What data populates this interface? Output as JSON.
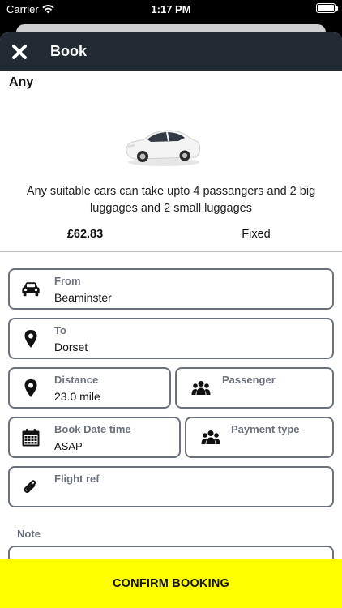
{
  "status_bar": {
    "carrier": "Carrier",
    "time": "1:17 PM"
  },
  "header": {
    "title": "Book",
    "close_icon": "close-icon"
  },
  "vehicle": {
    "name": "Any",
    "description": "Any suitable cars can take upto 4 passangers and 2 big luggages and 2 small luggages",
    "price": "£62.83",
    "fare_type": "Fixed"
  },
  "form": {
    "from": {
      "label": "From",
      "value": "Beaminster",
      "icon": "car-icon"
    },
    "to": {
      "label": "To",
      "value": "Dorset",
      "icon": "location-pin-icon"
    },
    "distance": {
      "label": "Distance",
      "value": "23.0 mile",
      "icon": "location-pin-icon"
    },
    "passenger": {
      "label": "Passenger",
      "value": "",
      "icon": "people-icon"
    },
    "book_datetime": {
      "label": "Book Date time",
      "value": "ASAP",
      "icon": "calendar-icon"
    },
    "payment_type": {
      "label": "Payment type",
      "value": "",
      "icon": "people-icon"
    },
    "flight_ref": {
      "label": "Flight ref",
      "value": "",
      "icon": "paperclip-icon"
    },
    "note": {
      "label": "Note",
      "value": ""
    }
  },
  "confirm_label": "CONFIRM BOOKING",
  "colors": {
    "header_bg": "#222a33",
    "confirm_bg": "#ffff00",
    "field_border": "#6b717b"
  }
}
